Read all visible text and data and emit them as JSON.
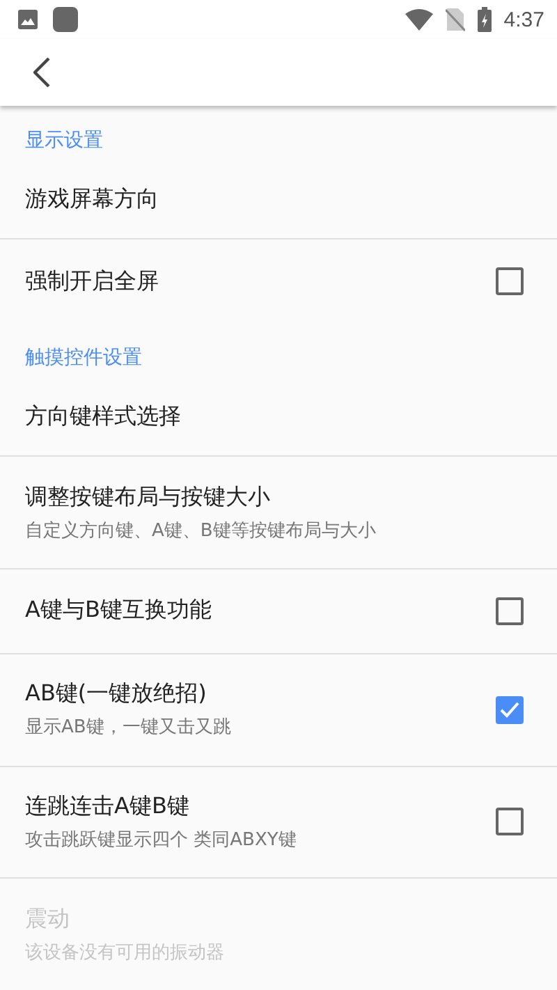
{
  "status_bar": {
    "time": "4:37"
  },
  "sections": [
    {
      "title": "显示设置",
      "items": [
        {
          "kind": "plain",
          "title": "游戏屏幕方向",
          "disabled": false
        },
        {
          "kind": "checkbox",
          "title": "强制开启全屏",
          "checked": false,
          "disabled": false
        }
      ]
    },
    {
      "title": "触摸控件设置",
      "items": [
        {
          "kind": "plain",
          "title": "方向键样式选择",
          "disabled": false
        },
        {
          "kind": "plain",
          "title": "调整按键布局与按键大小",
          "summary": "自定义方向键、A键、B键等按键布局与大小",
          "disabled": false
        },
        {
          "kind": "checkbox",
          "title": "A键与B键互换功能",
          "checked": false,
          "disabled": false
        },
        {
          "kind": "checkbox",
          "title": "AB键(一键放绝招)",
          "summary": "显示AB键，一键又击又跳",
          "checked": true,
          "disabled": false
        },
        {
          "kind": "checkbox",
          "title": "连跳连击A键B键",
          "summary": "攻击跳跃键显示四个 类同ABXY键",
          "checked": false,
          "disabled": false
        },
        {
          "kind": "plain",
          "title": "震动",
          "summary": "该设备没有可用的振动器",
          "disabled": true
        }
      ]
    }
  ]
}
